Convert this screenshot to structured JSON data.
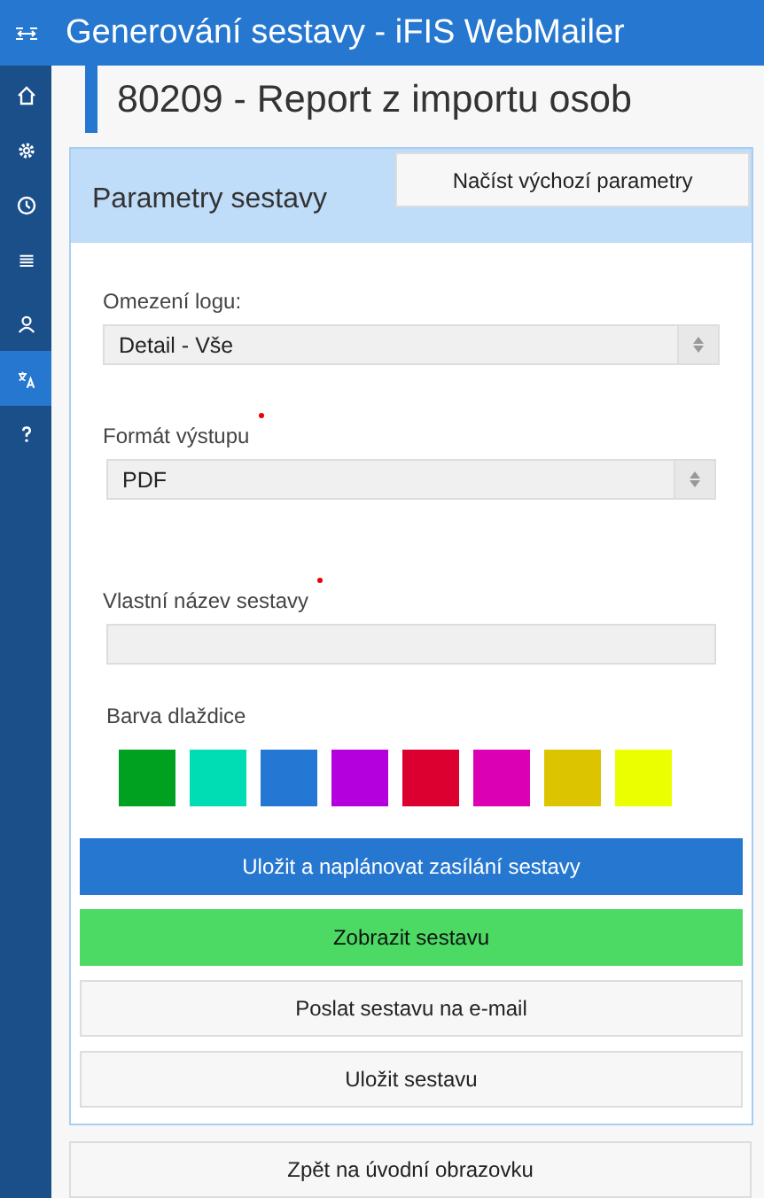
{
  "app_bar": {
    "title": "Generování sestavy - iFIS WebMailer"
  },
  "sidebar": {
    "items": [
      {
        "kind": "home",
        "selected": false
      },
      {
        "kind": "settings",
        "selected": false
      },
      {
        "kind": "history",
        "selected": false
      },
      {
        "kind": "list",
        "selected": false
      },
      {
        "kind": "user",
        "selected": false
      },
      {
        "kind": "translate",
        "selected": true
      },
      {
        "kind": "help",
        "selected": false
      }
    ]
  },
  "page_title": "80209 - Report z importu osob",
  "panel": {
    "title": "Parametry sestavy",
    "header_button": "Načíst výchozí parametry",
    "fields": [
      {
        "kind": "select",
        "label": "Omezení logu:",
        "required": false,
        "value": "Detail - Vše"
      },
      {
        "kind": "select",
        "label": "Formát výstupu",
        "required": true,
        "value": "PDF"
      },
      {
        "kind": "text",
        "label": "Vlastní název sestavy",
        "required": true
      }
    ],
    "swatch_label": "Barva dlaždice",
    "swatches": [
      {
        "color": "#00a020"
      },
      {
        "color": "#00dcb4"
      },
      {
        "color": "#2478d4"
      },
      {
        "color": "#b400dc"
      },
      {
        "color": "#dc0030"
      },
      {
        "color": "#dc00b4"
      },
      {
        "color": "#dcc400"
      },
      {
        "color": "#ecff00"
      }
    ],
    "buttons": [
      {
        "kind": "primary",
        "label": "Uložit a naplánovat zasílání sestavy"
      },
      {
        "kind": "success",
        "label": "Zobrazit sestavu"
      },
      {
        "kind": "default",
        "label": "Poslat sestavu na e-mail"
      },
      {
        "kind": "default",
        "label": "Uložit sestavu"
      }
    ]
  },
  "footer_button": "Zpět na úvodní obrazovku"
}
